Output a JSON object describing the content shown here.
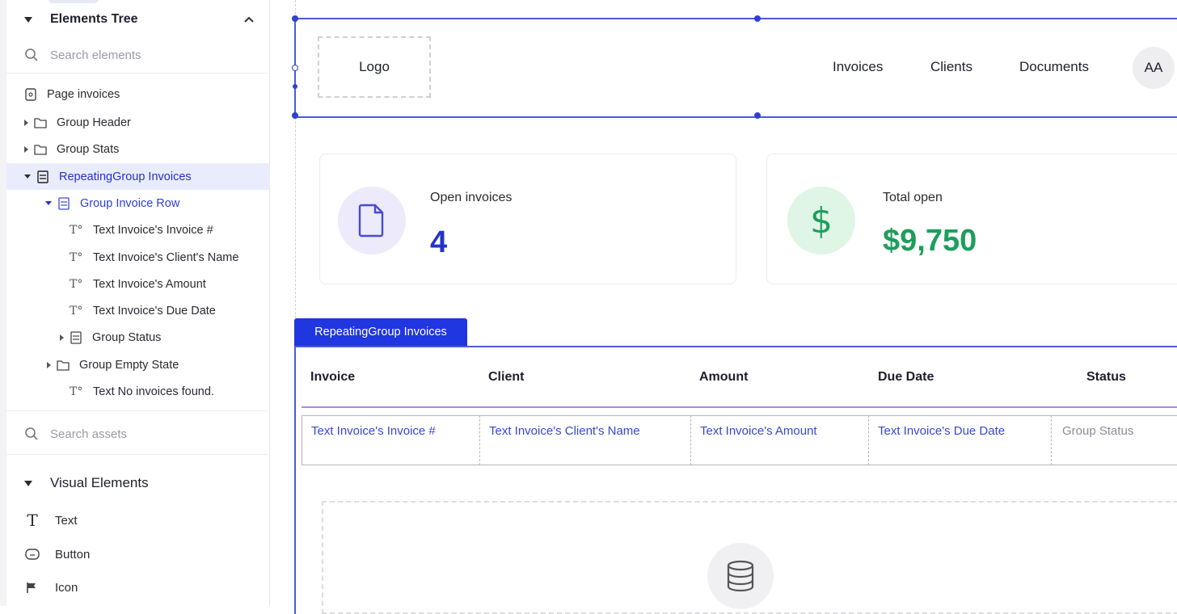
{
  "sidebar": {
    "elements_tree_title": "Elements Tree",
    "search_elements_placeholder": "Search elements",
    "tree": [
      {
        "label": "Page invoices"
      },
      {
        "label": "Group Header"
      },
      {
        "label": "Group Stats"
      },
      {
        "label": "RepeatingGroup Invoices"
      },
      {
        "label": "Group Invoice Row"
      },
      {
        "label": "Text Invoice's Invoice #"
      },
      {
        "label": "Text Invoice's Client's Name"
      },
      {
        "label": "Text Invoice's Amount"
      },
      {
        "label": "Text Invoice's Due Date"
      },
      {
        "label": "Group Status"
      },
      {
        "label": "Group Empty State"
      },
      {
        "label": "Text No invoices found."
      }
    ],
    "search_assets_placeholder": "Search assets",
    "visual_elements_title": "Visual Elements",
    "visual_items": [
      {
        "label": "Text",
        "icon": "text-icon"
      },
      {
        "label": "Button",
        "icon": "button-icon"
      },
      {
        "label": "Icon",
        "icon": "flag-icon"
      }
    ]
  },
  "header": {
    "logo": "Logo",
    "nav": [
      "Invoices",
      "Clients",
      "Documents"
    ],
    "avatar_initials": "AA"
  },
  "stats": {
    "open_invoices_label": "Open invoices",
    "open_invoices_value": "4",
    "total_open_label": "Total open",
    "total_open_value": "$9,750"
  },
  "repeating_group": {
    "tab_label": "RepeatingGroup Invoices",
    "columns": [
      "Invoice",
      "Client",
      "Amount",
      "Due Date",
      "Status"
    ],
    "row_cells": [
      "Text Invoice's Invoice #",
      "Text Invoice's Client's Name",
      "Text Invoice's Amount",
      "Text Invoice's Due Date",
      "Group Status"
    ]
  },
  "colors": {
    "accent": "#1f36e0",
    "selection": "#4b5bd9",
    "invoice_value": "#2233cc",
    "money_value": "#1e9e5c",
    "doc_circle": "#eceafb",
    "money_circle": "#dff5e6"
  }
}
